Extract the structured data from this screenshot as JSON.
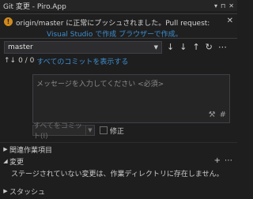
{
  "window": {
    "title": "Git 変更 - Piro.App",
    "title_icons": [
      "▾",
      "⊓",
      "✕"
    ]
  },
  "infobar": {
    "message": "origin/master に正常にプッシュされました。Pull request:",
    "link1": "Visual Studio で作成",
    "link2": "ブラウザーで作成。",
    "accent": "#d08a1c",
    "link_color": "#3d8fd1"
  },
  "branch": {
    "current": "master"
  },
  "toolbar": {
    "fetch": "↓",
    "pull": "↓",
    "push": "↑",
    "sync": "↻",
    "more": "⋯"
  },
  "commits": {
    "count": "0 / 0",
    "show_all": "すべてのコミットを表示する"
  },
  "message_box": {
    "placeholder": "メッセージを入力してください <必須>"
  },
  "commit_controls": {
    "commit_all": "すべてをコミット(I)",
    "amend": "修正"
  },
  "sections": {
    "related_items": "関連作業項目",
    "changes": "変更",
    "changes_empty": "ステージされていない変更は、作業ディレクトリに存在しません。",
    "stashes": "スタッシュ"
  }
}
